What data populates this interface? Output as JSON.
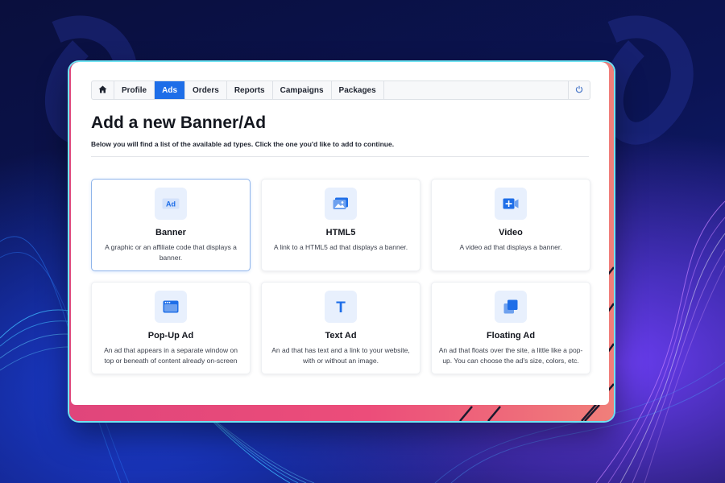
{
  "colors": {
    "accent": "#1e6ee8",
    "icon_bg": "#e8f0fd",
    "frame_gradient_start": "#e0457b",
    "frame_gradient_end": "#f07f7a",
    "frame_outline": "#6fe3f2"
  },
  "navbar": {
    "home_icon": "home-icon",
    "items": [
      {
        "label": "Profile",
        "active": false
      },
      {
        "label": "Ads",
        "active": true
      },
      {
        "label": "Orders",
        "active": false
      },
      {
        "label": "Reports",
        "active": false
      },
      {
        "label": "Campaigns",
        "active": false
      },
      {
        "label": "Packages",
        "active": false
      }
    ],
    "power_icon": "power-icon"
  },
  "page": {
    "title": "Add a new Banner/Ad",
    "subtitle": "Below you will find a list of the available ad types. Click the one you'd like to add to continue."
  },
  "ad_types": [
    {
      "title": "Banner",
      "description": "A graphic or an affiliate code that displays a banner.",
      "icon": "ad-badge-icon",
      "icon_text": "Ad",
      "selected": true
    },
    {
      "title": "HTML5",
      "description": "A link to a HTML5 ad that displays a banner.",
      "icon": "image-icon",
      "selected": false
    },
    {
      "title": "Video",
      "description": "A video ad that displays a banner.",
      "icon": "video-plus-icon",
      "selected": false
    },
    {
      "title": "Pop-Up Ad",
      "description": "An ad that appears in a separate window on top or beneath of content already on-screen",
      "icon": "browser-window-icon",
      "selected": false
    },
    {
      "title": "Text Ad",
      "description": "An ad that has text and a link to your website, with or without an image.",
      "icon": "text-icon",
      "icon_text": "T",
      "selected": false
    },
    {
      "title": "Floating Ad",
      "description": "An ad that floats over the site, a little like a pop-up. You can choose the ad's size, colors, etc.",
      "icon": "stacked-squares-icon",
      "selected": false
    }
  ]
}
